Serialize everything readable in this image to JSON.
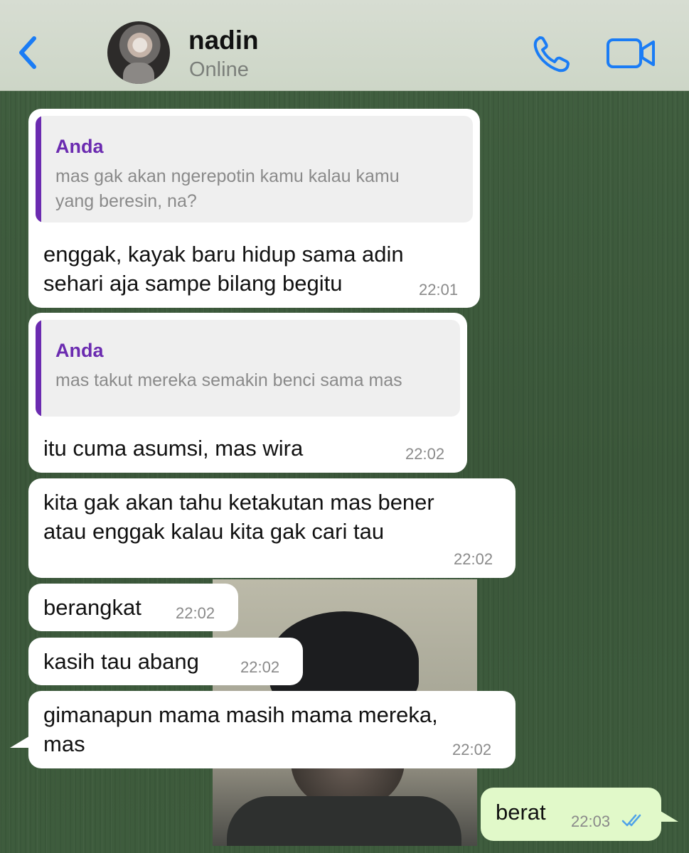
{
  "header": {
    "contact_name": "nadin",
    "status": "Online",
    "back_icon": "chevron-left-icon",
    "call_icon": "phone-icon",
    "video_icon": "video-camera-icon",
    "accent_color": "#1a7cf5"
  },
  "messages": [
    {
      "quote_author": "Anda",
      "quote_text": "mas gak akan ngerepotin kamu kalau kamu\nyang beresin, na?",
      "text": "enggak, kayak baru hidup sama adin\nsehari aja sampe bilang begitu",
      "time": "22:01"
    },
    {
      "quote_author": "Anda",
      "quote_text": "mas takut mereka semakin benci sama mas",
      "text": "itu cuma asumsi, mas wira",
      "time": "22:02"
    },
    {
      "text": "kita gak akan tahu ketakutan mas bener\natau enggak kalau kita gak cari tau",
      "time": "22:02"
    },
    {
      "text": "berangkat",
      "time": "22:02"
    },
    {
      "text": "kasih tau abang",
      "time": "22:02"
    },
    {
      "text": "gimanapun mama masih mama mereka,\nmas",
      "time": "22:02"
    },
    {
      "text": "berat",
      "time": "22:03",
      "outgoing": true,
      "status": "read"
    }
  ],
  "colors": {
    "quote_accent": "#6b2bb0",
    "outgoing_bubble": "#e1f9c9",
    "read_ticks": "#4fa3e8"
  }
}
